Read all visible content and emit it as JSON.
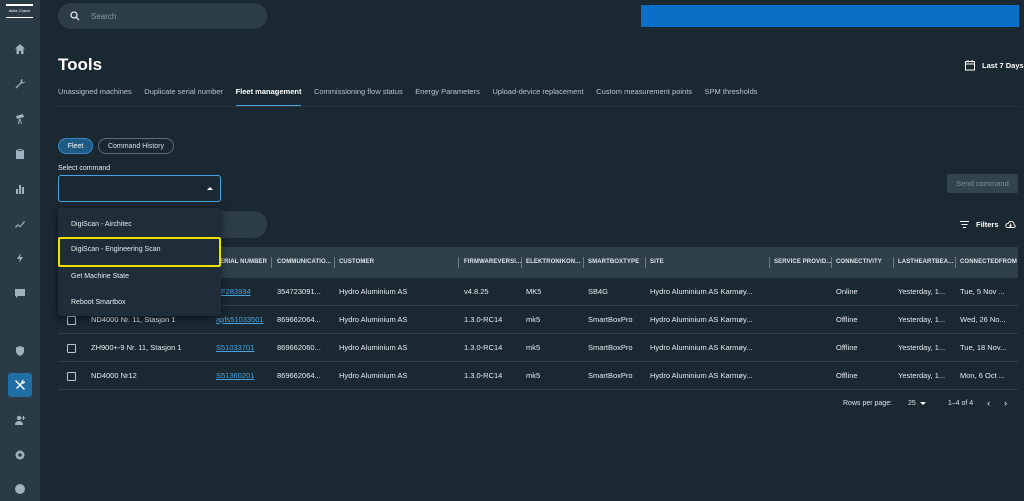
{
  "brand": {
    "logo_text": "Atlas Copco"
  },
  "search": {
    "placeholder": "Search"
  },
  "page": {
    "title": "Tools",
    "date_range": "Last 7 Days"
  },
  "tabs": [
    {
      "label": "Unassigned machines"
    },
    {
      "label": "Duplicate serial number"
    },
    {
      "label": "Fleet management",
      "active": true
    },
    {
      "label": "Commissioning flow status"
    },
    {
      "label": "Energy Parameters"
    },
    {
      "label": "Upload-device replacement"
    },
    {
      "label": "Custom measurement points"
    },
    {
      "label": "SPM thresholds"
    }
  ],
  "chips": {
    "fleet": "Fleet",
    "command_history": "Command History"
  },
  "select": {
    "label": "Select command",
    "value": ""
  },
  "send_button": "Send command",
  "filters_label": "Filters",
  "dropdown": {
    "items": [
      "DigiScan - Airchitec",
      "DigiScan - Engineering Scan",
      "Get Machine State",
      "Reboot Smartbox"
    ],
    "highlighted_index": 1
  },
  "table": {
    "columns": [
      "ERIAL NUMBER",
      "COMMUNICATIO...",
      "CUSTOMER",
      "FIRMWAREVERSI...",
      "ELEKTRONIKON...",
      "SMARTBOXTYPE",
      "SITE",
      "SERVICE PROVID...",
      "CONNECTIVITY",
      "LASTHEARTBEA...",
      "CONNECTEDFROM"
    ],
    "rows": [
      {
        "name": "",
        "serial": "PF283934",
        "comm": "354723091...",
        "customer": "Hydro Aluminium AS",
        "firmware": "v4.8.25",
        "elektronikon": "MK5",
        "smartbox": "SB4G",
        "site": "Hydro Aluminium AS Karmøy...",
        "service": "",
        "connectivity": "Online",
        "heartbeat": "Yesterday, 1...",
        "connected_from": "Tue, 5 Nov ..."
      },
      {
        "name": "ND4000 Nr. 11, Stasjon 1",
        "serial": "apfs51033501",
        "comm": "869662064...",
        "customer": "Hydro Aluminium AS",
        "firmware": "1.3.0-RC14",
        "elektronikon": "mk5",
        "smartbox": "SmartBoxPro",
        "site": "Hydro Aluminium AS Karmøy...",
        "service": "",
        "connectivity": "Offline",
        "heartbeat": "Yesterday, 1...",
        "connected_from": "Wed, 26 No..."
      },
      {
        "name": "ZH900+-9 Nr. 11, Stasjon 1",
        "serial": "S51033701",
        "comm": "869662060...",
        "customer": "Hydro Aluminium AS",
        "firmware": "1.3.0-RC14",
        "elektronikon": "mk5",
        "smartbox": "SmartBoxPro",
        "site": "Hydro Aluminium AS Karmøy...",
        "service": "",
        "connectivity": "Offline",
        "heartbeat": "Yesterday, 1...",
        "connected_from": "Tue, 18 Nov..."
      },
      {
        "name": "ND4000 Nr12",
        "serial": "S51360201",
        "comm": "869662064...",
        "customer": "Hydro Aluminium AS",
        "firmware": "1.3.0-RC14",
        "elektronikon": "mk5",
        "smartbox": "SmartBoxPro",
        "site": "Hydro Aluminium AS Karmøy...",
        "service": "",
        "connectivity": "Offline",
        "heartbeat": "Yesterday, 1...",
        "connected_from": "Mon, 6 Oct ..."
      }
    ]
  },
  "pagination": {
    "rows_per_page_label": "Rows per page:",
    "rows_per_page": "25",
    "range": "1–4 of 4",
    "prev": "‹",
    "next": "›"
  },
  "sidebar_icons": [
    "home-icon",
    "wrench-icon",
    "telescope-icon",
    "clipboard-icon",
    "bar-chart-icon",
    "trend-icon",
    "bolt-icon",
    "message-icon",
    "shield-gear-icon",
    "tools-icon",
    "add-user-icon",
    "settings-icon",
    "help-icon"
  ]
}
